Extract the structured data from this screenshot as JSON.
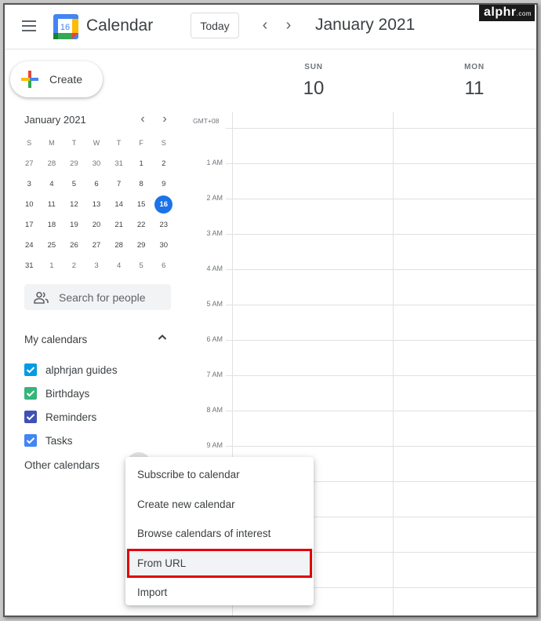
{
  "header": {
    "app_title": "Calendar",
    "logo_day": "16",
    "today_label": "Today",
    "prev_icon": "chevron-left-icon",
    "next_icon": "chevron-right-icon",
    "current_period": "January 2021",
    "watermark": "alphr",
    "watermark_suffix": ".com"
  },
  "sidebar": {
    "create_label": "Create",
    "mini_calendar": {
      "title": "January 2021",
      "weekdays": [
        "S",
        "M",
        "T",
        "W",
        "T",
        "F",
        "S"
      ],
      "weeks": [
        [
          "27",
          "28",
          "29",
          "30",
          "31",
          "1",
          "2"
        ],
        [
          "3",
          "4",
          "5",
          "6",
          "7",
          "8",
          "9"
        ],
        [
          "10",
          "11",
          "12",
          "13",
          "14",
          "15",
          "16"
        ],
        [
          "17",
          "18",
          "19",
          "20",
          "21",
          "22",
          "23"
        ],
        [
          "24",
          "25",
          "26",
          "27",
          "28",
          "29",
          "30"
        ],
        [
          "31",
          "1",
          "2",
          "3",
          "4",
          "5",
          "6"
        ]
      ],
      "today": "16"
    },
    "search_people_placeholder": "Search for people",
    "my_calendars": {
      "title": "My calendars",
      "items": [
        {
          "label": "alphrjan guides",
          "color": "#039be5",
          "checked": true
        },
        {
          "label": "Birthdays",
          "color": "#33b679",
          "checked": true
        },
        {
          "label": "Reminders",
          "color": "#3f51b5",
          "checked": true
        },
        {
          "label": "Tasks",
          "color": "#4285f4",
          "checked": true
        }
      ]
    },
    "other_calendars": {
      "title": "Other calendars"
    }
  },
  "main": {
    "timezone": "GMT+08",
    "days": [
      {
        "dow": "SUN",
        "date": "10"
      },
      {
        "dow": "MON",
        "date": "11"
      }
    ],
    "hours": [
      "1 AM",
      "2 AM",
      "3 AM",
      "4 AM",
      "5 AM",
      "6 AM",
      "7 AM",
      "8 AM",
      "9 AM"
    ]
  },
  "menu": {
    "items": [
      {
        "label": "Subscribe to calendar",
        "highlighted": false
      },
      {
        "label": "Create new calendar",
        "highlighted": false
      },
      {
        "label": "Browse calendars of interest",
        "highlighted": false
      },
      {
        "label": "From URL",
        "highlighted": true
      },
      {
        "label": "Import",
        "highlighted": false
      }
    ]
  },
  "colors": {
    "accent": "#1a73e8",
    "highlight_box": "#e0000b"
  }
}
